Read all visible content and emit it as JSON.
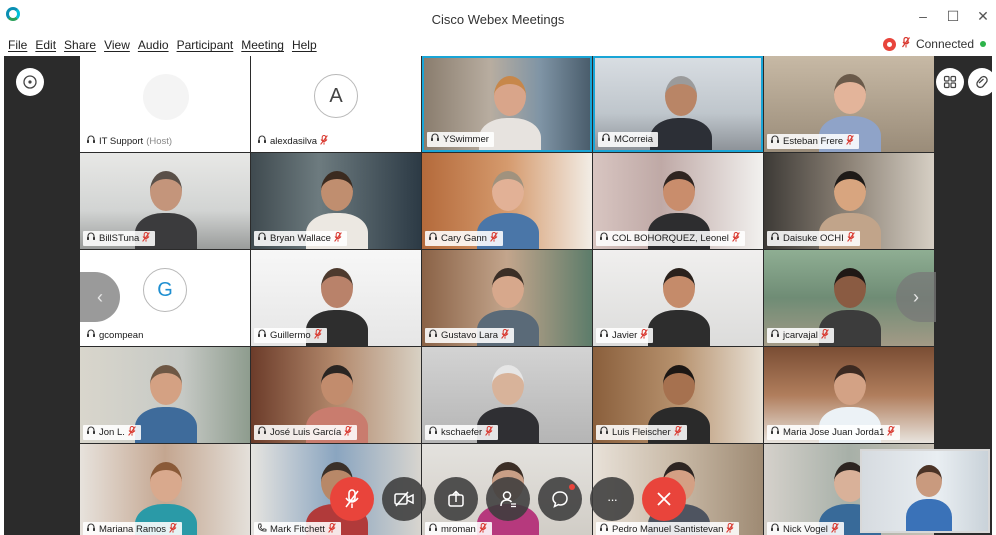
{
  "window": {
    "title": "Cisco Webex Meetings",
    "controls": {
      "minimize": "–",
      "maximize": "☐",
      "close": "✕"
    }
  },
  "menu": {
    "items": [
      "File",
      "Edit",
      "Share",
      "View",
      "Audio",
      "Participant",
      "Meeting",
      "Help"
    ]
  },
  "status": {
    "text": "Connected",
    "recording_color": "#e8453c",
    "connected_color": "#2db34a"
  },
  "colors": {
    "active_speaker_border": "#19a5d6",
    "mute_red": "#d9382f",
    "end_red": "#e9443b"
  },
  "participants": [
    {
      "name": "IT Support",
      "suffix": "(Host)",
      "muted": false,
      "video": false,
      "avatar": ""
    },
    {
      "name": "alexdasilva",
      "muted": true,
      "video": false,
      "avatar": "A"
    },
    {
      "name": "YSwimmer",
      "muted": false,
      "video": true,
      "active": true
    },
    {
      "name": "MCorreia",
      "muted": false,
      "video": true,
      "active": true
    },
    {
      "name": "Esteban Frere",
      "muted": true,
      "video": true
    },
    {
      "name": "BillSTuna",
      "muted": true,
      "video": true
    },
    {
      "name": "Bryan Wallace",
      "muted": true,
      "video": true
    },
    {
      "name": "Cary Gann",
      "muted": true,
      "video": true
    },
    {
      "name": "COL BOHORQUEZ, Leonel",
      "muted": true,
      "video": true
    },
    {
      "name": "Daisuke OCHI",
      "muted": true,
      "video": true
    },
    {
      "name": "gcompean",
      "muted": false,
      "video": false,
      "avatar": "G"
    },
    {
      "name": "Guillermo",
      "muted": true,
      "video": true
    },
    {
      "name": "Gustavo Lara",
      "muted": true,
      "video": true
    },
    {
      "name": "Javier",
      "muted": true,
      "video": true
    },
    {
      "name": "jcarvajal",
      "muted": true,
      "video": true
    },
    {
      "name": "Jon L.",
      "muted": true,
      "video": true
    },
    {
      "name": "José Luis García",
      "muted": true,
      "video": true
    },
    {
      "name": "kschaefer",
      "muted": true,
      "video": true
    },
    {
      "name": "Luis Fleischer",
      "muted": true,
      "video": true
    },
    {
      "name": "Maria Jose Juan Jorda1",
      "muted": true,
      "video": true
    },
    {
      "name": "Mariana Ramos",
      "muted": true,
      "video": true
    },
    {
      "name": "Mark Fitchett",
      "muted": true,
      "video": true,
      "phone": true
    },
    {
      "name": "mroman",
      "muted": true,
      "video": true
    },
    {
      "name": "Pedro Manuel Santistevan",
      "muted": true,
      "video": true
    },
    {
      "name": "Nick Vogel",
      "muted": true,
      "video": true
    }
  ],
  "nav": {
    "prev": "‹",
    "next": "›"
  },
  "toolbar": {
    "buttons": [
      "mute-button",
      "stop-video-button",
      "share-button",
      "participants-button",
      "chat-button",
      "more-button",
      "leave-button"
    ],
    "more_label": "···"
  }
}
